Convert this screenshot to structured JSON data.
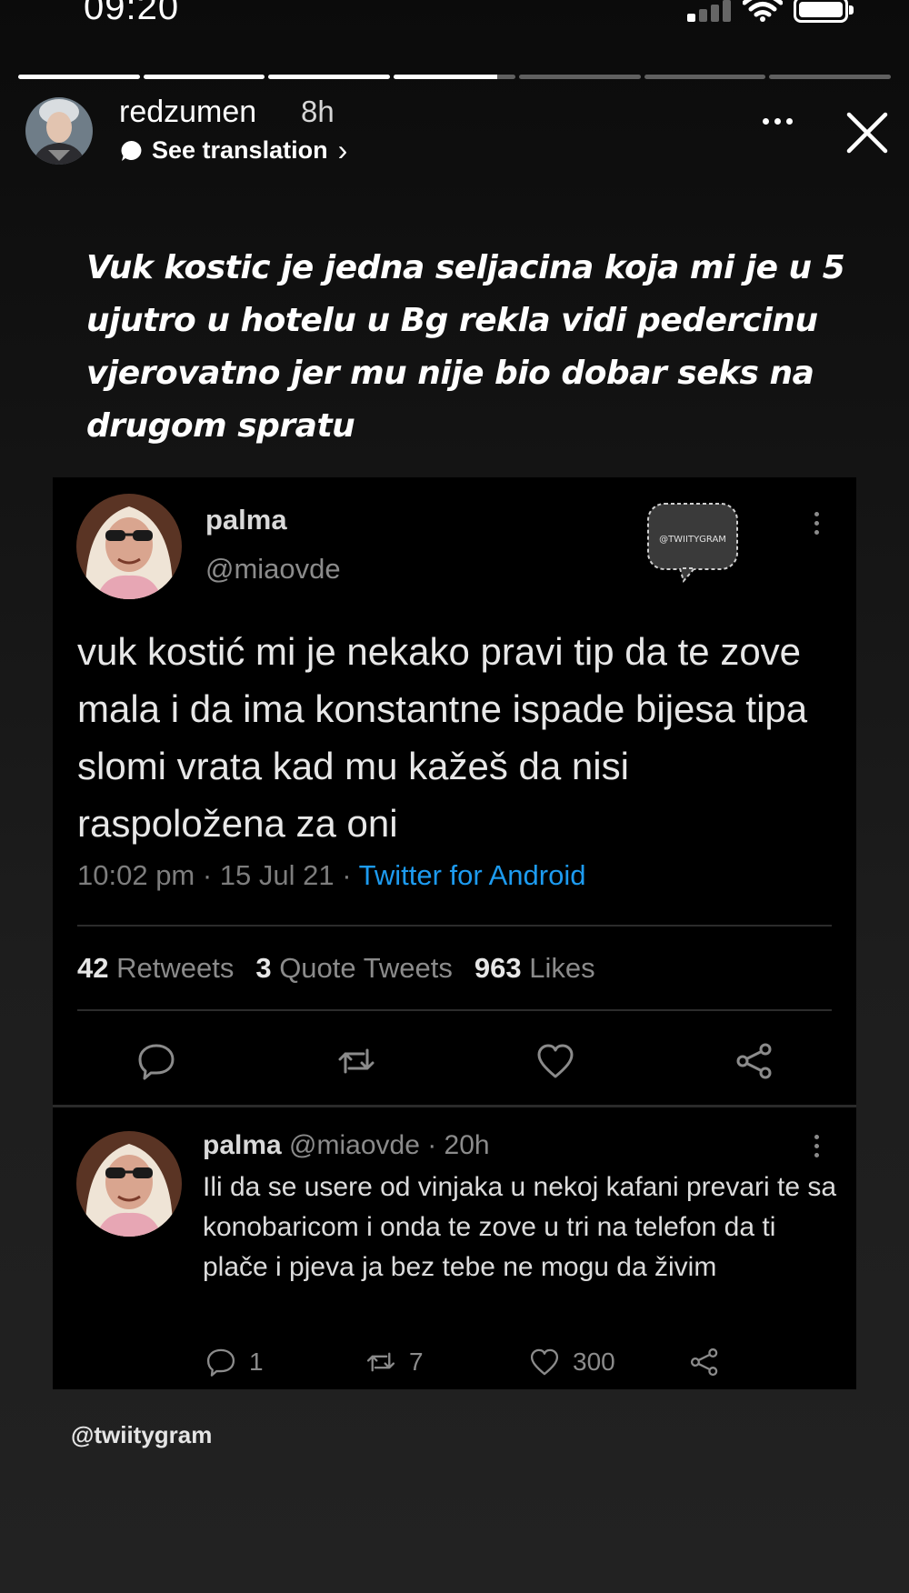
{
  "status_bar": {
    "time": "09:20",
    "battery_level": 1.0,
    "signal_bars_active": 1,
    "signal_bars_total": 4
  },
  "story": {
    "progress": [
      1,
      1,
      1,
      0.85,
      0,
      0,
      0
    ],
    "username": "redzumen",
    "time_ago": "8h",
    "translation_label": "See translation",
    "translation_chevron": "›",
    "caption": "Vuk kostic je jedna seljacina koja mi je u 5 ujutro u hotelu u Bg rekla vidi pedercinu vjerovatno jer mu nije bio dobar seks na drugom spratu"
  },
  "tweet": {
    "name": "palma",
    "handle": "@miaovde",
    "watermark": "@TWIITYGRAM",
    "text": "vuk kostić mi je nekako pravi tip da te zove mala i da ima konstantne ispade bijesa tipa slomi vrata kad mu kažeš da nisi raspoložena za oni",
    "datetime": "10:02 pm · 15 Jul 21 · ",
    "source": "Twitter for Android",
    "retweets_count": "42",
    "retweets_label": " Retweets",
    "quotes_count": "3",
    "quotes_label": " Quote Tweets",
    "likes_count": "963",
    "likes_label": " Likes",
    "actions": [
      "reply-icon",
      "retweet-icon",
      "like-icon",
      "share-icon"
    ]
  },
  "reply": {
    "name": "palma",
    "meta": " @miaovde · 20h",
    "text": "Ili da se usere od vinjaka u nekoj kafani prevari te sa konobaricom i onda te zove u tri na telefon da ti plače i pjeva ja bez tebe ne mogu da živim",
    "reply_count": "1",
    "retweet_count": "7",
    "like_count": "300"
  },
  "footer": {
    "handle": "@twiitygram"
  },
  "colors": {
    "link": "#1d9bf0",
    "muted": "#8b8b8b",
    "card": "#000000"
  }
}
